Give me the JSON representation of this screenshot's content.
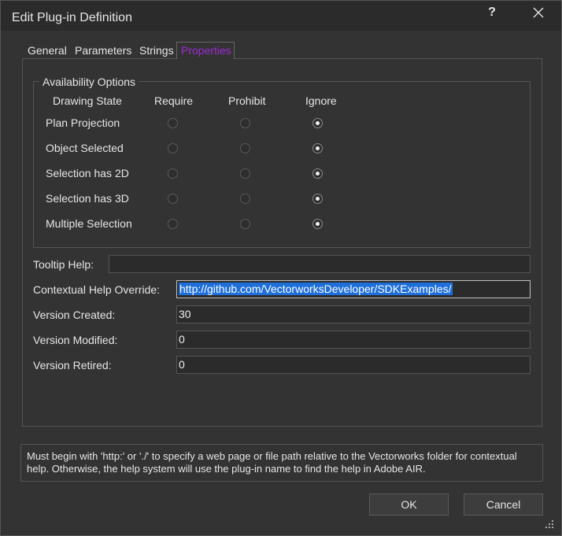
{
  "window": {
    "title": "Edit Plug-in Definition",
    "help_glyph": "?",
    "close_icon": "close-icon"
  },
  "tabs": [
    {
      "label": "General",
      "active": false
    },
    {
      "label": "Parameters",
      "active": false
    },
    {
      "label": "Strings",
      "active": false
    },
    {
      "label": "Properties",
      "active": true
    }
  ],
  "availability": {
    "legend": "Availability Options",
    "columns": [
      "Drawing State",
      "Require",
      "Prohibit",
      "Ignore"
    ],
    "rows": [
      {
        "label": "Plan Projection",
        "selected": "Ignore"
      },
      {
        "label": "Object Selected",
        "selected": "Ignore"
      },
      {
        "label": "Selection has 2D",
        "selected": "Ignore"
      },
      {
        "label": "Selection has 3D",
        "selected": "Ignore"
      },
      {
        "label": "Multiple Selection",
        "selected": "Ignore"
      }
    ]
  },
  "fields": {
    "tooltip": {
      "label": "Tooltip Help:",
      "value": ""
    },
    "contextual": {
      "label": "Contextual Help Override:",
      "value": "http://github.com/VectorworksDeveloper/SDKExamples/"
    },
    "created": {
      "label": "Version Created:",
      "value": "30"
    },
    "modified": {
      "label": "Version Modified:",
      "value": "0"
    },
    "retired": {
      "label": "Version Retired:",
      "value": "0"
    }
  },
  "help_text": "Must begin with 'http:' or './' to specify a web page or file path relative to the Vectorworks folder for contextual help.  Otherwise, the help system will use the plug-in name to find the help in Adobe AIR.",
  "buttons": {
    "ok": "OK",
    "cancel": "Cancel"
  },
  "colors": {
    "active_tab": "#9d2ad4",
    "selection": "#1e6fd9",
    "background": "#333333"
  }
}
